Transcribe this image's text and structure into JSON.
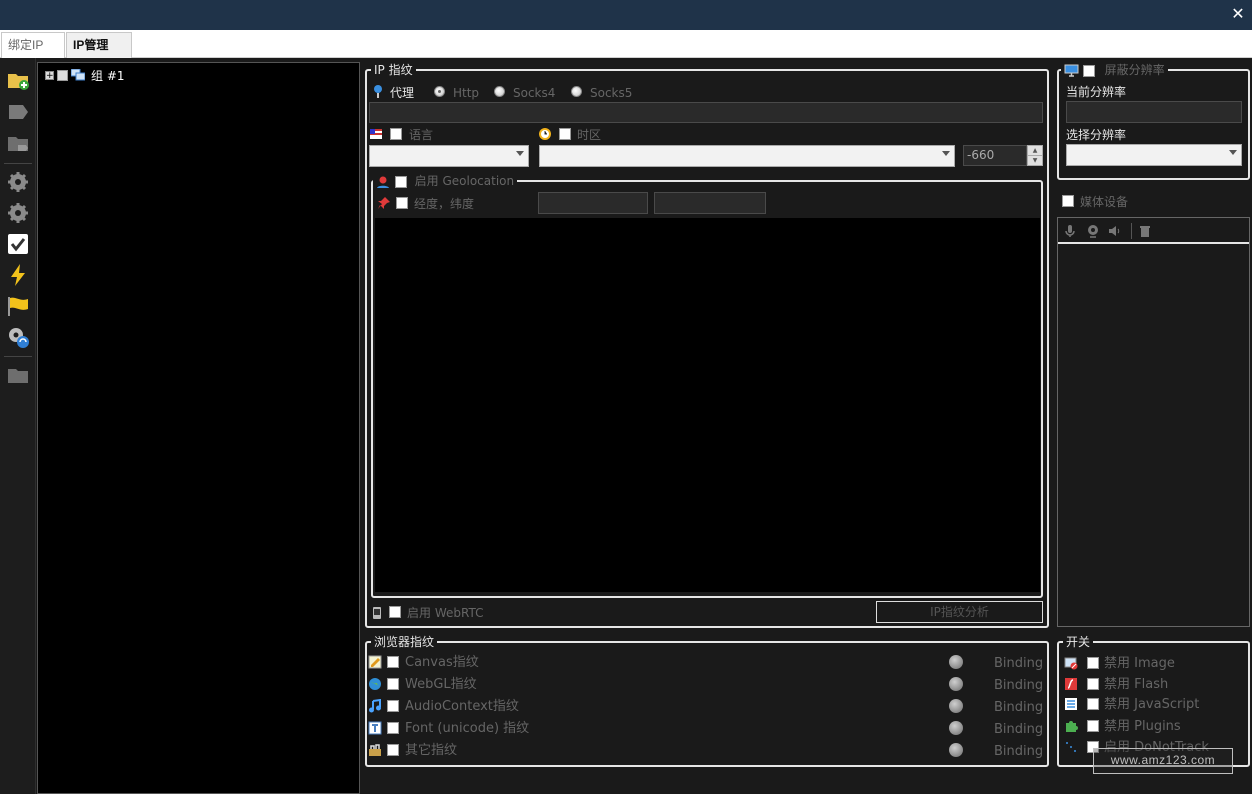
{
  "window": {
    "close_glyph": "✕"
  },
  "tabs": [
    {
      "label": "绑定IP",
      "active": false
    },
    {
      "label": "IP管理",
      "active": true
    }
  ],
  "toolbar": {
    "icons": [
      "folder-add-icon",
      "tag-icon",
      "folder-tag-icon",
      "gear-icon",
      "gear-icon",
      "check-icon",
      "lightning-icon",
      "flag-icon",
      "gear-refresh-icon",
      "folder-icon"
    ]
  },
  "tree": {
    "group_label": "组 #1",
    "expander": "+"
  },
  "ip_fingerprint": {
    "legend": "IP 指纹",
    "proxy_label": "代理",
    "proxy_types": [
      {
        "label": "Http",
        "selected": true
      },
      {
        "label": "Socks4",
        "selected": false
      },
      {
        "label": "Socks5",
        "selected": false
      }
    ],
    "proxy_value": "",
    "language_label": "语言",
    "timezone_label": "时区",
    "timezone_offset": "-660",
    "geolocation_legend": "启用 Geolocation",
    "latlng_label": "经度，纬度",
    "webrtc_label": "启用 WebRTC",
    "analyze_button": "IP指纹分析"
  },
  "resolution": {
    "legend": "屏蔽分辨率",
    "current_label": "当前分辨率",
    "current_value": "",
    "choose_label": "选择分辨率"
  },
  "media": {
    "label": "媒体设备"
  },
  "browser_fingerprint": {
    "legend": "浏览器指纹",
    "items": [
      {
        "label": "Canvas指纹",
        "binding": "Binding"
      },
      {
        "label": "WebGL指纹",
        "binding": "Binding"
      },
      {
        "label": "AudioContext指纹",
        "binding": "Binding"
      },
      {
        "label": "Font (unicode) 指纹",
        "binding": "Binding"
      },
      {
        "label": "其它指纹",
        "binding": "Binding"
      }
    ]
  },
  "switches": {
    "legend": "开关",
    "items": [
      {
        "label": "禁用 Image"
      },
      {
        "label": "禁用 Flash"
      },
      {
        "label": "禁用 JavaScript"
      },
      {
        "label": "禁用 Plugins"
      },
      {
        "label": "启用 DoNotTrack"
      }
    ]
  },
  "watermark": "www.amz123.com",
  "colors": {
    "titlebar": "#1f3349",
    "background": "#1a1a1a",
    "map": "#000000"
  }
}
